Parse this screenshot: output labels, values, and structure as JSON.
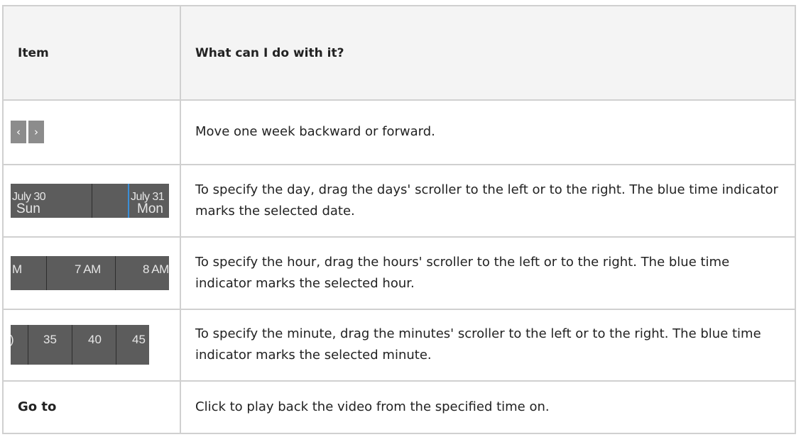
{
  "table": {
    "headers": {
      "item": "Item",
      "description": "What can I do with it?"
    },
    "rows": [
      {
        "nav_prev_icon": "chevron-left-icon",
        "nav_prev_glyph": "‹",
        "nav_next_icon": "chevron-right-icon",
        "nav_next_glyph": "›",
        "description": "Move one week backward or forward."
      },
      {
        "scroller": {
          "date_left": "July 30",
          "day_left": "Sun",
          "date_right": "July 31",
          "day_right": "Mon"
        },
        "description": "To specify the day, drag the days' scroller to the left or to the right. The blue time indicator marks the selected date."
      },
      {
        "scroller": {
          "left_partial": "M",
          "mid": "7 AM",
          "right": "8 AM"
        },
        "description": "To specify the hour, drag the hours' scroller to the left or to the right. The blue time indicator marks the selected hour."
      },
      {
        "scroller": {
          "left_partial": ")",
          "a": "35",
          "b": "40",
          "c": "45"
        },
        "description": "To specify the minute, drag the minutes' scroller to the left or to the right. The blue time indicator marks the selected minute."
      },
      {
        "item": "Go to",
        "description": "Click to play back the video from the specified time on."
      }
    ]
  },
  "colors": {
    "scroller_bg": "#5c5c5c",
    "indicator": "#3a8fd8",
    "nav_button": "#8c8c8c",
    "header_bg": "#f4f4f4",
    "border": "#d0d0d0"
  }
}
